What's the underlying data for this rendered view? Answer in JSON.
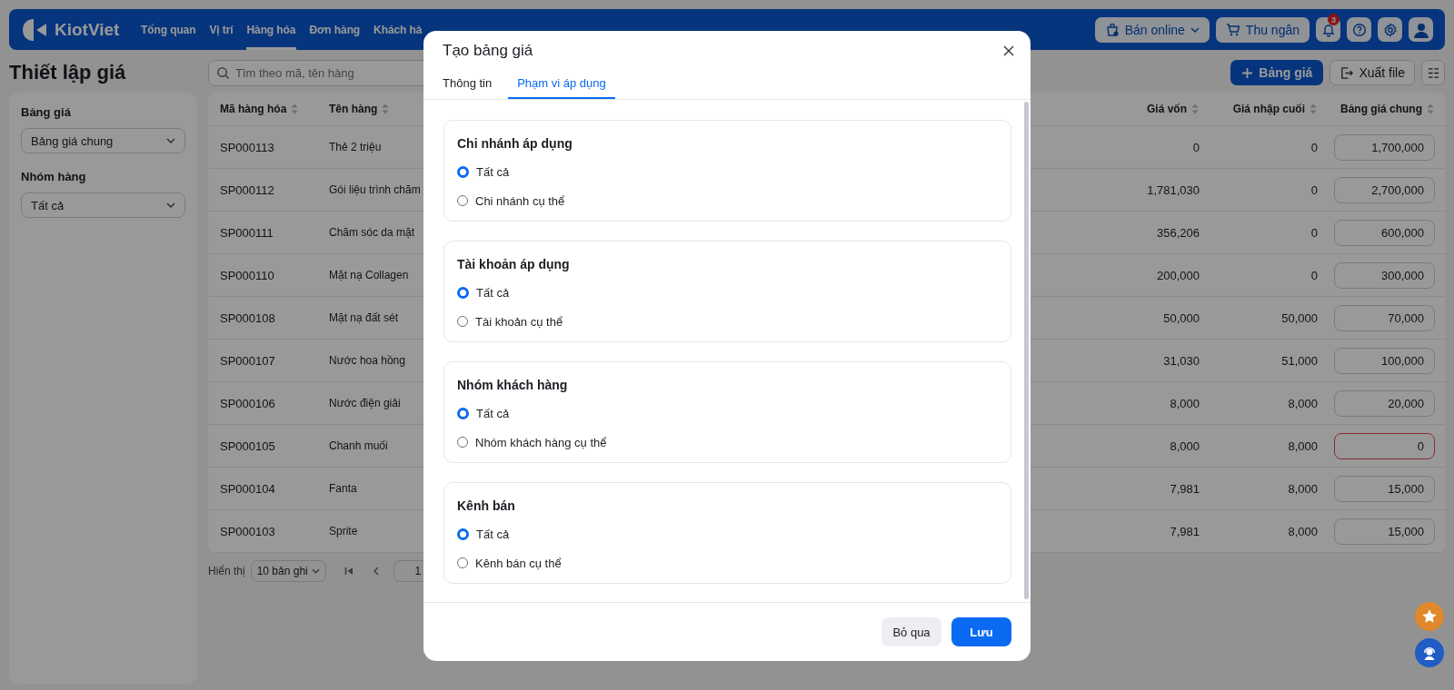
{
  "topbar": {
    "logo": "KiotViet",
    "nav": [
      {
        "label": "Tổng quan",
        "selected": false
      },
      {
        "label": "Vị trí",
        "selected": false
      },
      {
        "label": "Hàng hóa",
        "selected": true
      },
      {
        "label": "Đơn hàng",
        "selected": false
      },
      {
        "label": "Khách hà",
        "selected": false
      }
    ],
    "actions": [
      {
        "kind": "store",
        "label": "Bán online"
      },
      {
        "kind": "cashier",
        "label": "Thu ngân"
      }
    ],
    "notification_count": "3"
  },
  "page": {
    "title": "Thiết lập giá",
    "search": {
      "placeholder": "Tìm theo mã, tên hàng"
    },
    "add_button": "Bảng giá",
    "export_button": "Xuất file"
  },
  "filters": [
    {
      "label": "Bảng giá",
      "value": "Bảng giá chung"
    },
    {
      "label": "Nhóm hàng",
      "value": "Tất cả"
    }
  ],
  "table": {
    "columns": [
      "Mã hàng hóa",
      "Tên hàng",
      "Giá vốn",
      "Giá nhập cuối",
      "Bảng giá chung"
    ],
    "rows": [
      {
        "code": "SP000113",
        "name": "Thẻ 2 triệu",
        "cost": "0",
        "last_import": "0",
        "price": "1,700,000",
        "error": false
      },
      {
        "code": "SP000112",
        "name": "Gói liệu trình chăm",
        "cost": "1,781,030",
        "last_import": "0",
        "price": "2,700,000",
        "error": false
      },
      {
        "code": "SP000111",
        "name": "Chăm sóc da mặt",
        "cost": "356,206",
        "last_import": "0",
        "price": "600,000",
        "error": false
      },
      {
        "code": "SP000110",
        "name": "Mặt nạ Collagen",
        "cost": "200,000",
        "last_import": "0",
        "price": "300,000",
        "error": false
      },
      {
        "code": "SP000108",
        "name": "Mặt nạ đất sét",
        "cost": "50,000",
        "last_import": "50,000",
        "price": "70,000",
        "error": false
      },
      {
        "code": "SP000107",
        "name": "Nước hoa hồng",
        "cost": "31,030",
        "last_import": "51,000",
        "price": "100,000",
        "error": false
      },
      {
        "code": "SP000106",
        "name": "Nước điện giải",
        "cost": "8,000",
        "last_import": "8,000",
        "price": "20,000",
        "error": false
      },
      {
        "code": "SP000105",
        "name": "Chanh muối",
        "cost": "8,000",
        "last_import": "8,000",
        "price": "0",
        "error": true
      },
      {
        "code": "SP000104",
        "name": "Fanta",
        "cost": "7,981",
        "last_import": "8,000",
        "price": "15,000",
        "error": false
      },
      {
        "code": "SP000103",
        "name": "Sprite",
        "cost": "7,981",
        "last_import": "8,000",
        "price": "15,000",
        "error": false
      }
    ]
  },
  "pagination": {
    "label": "Hiển thị",
    "page_size": "10 bản ghi",
    "page": "1"
  },
  "modal": {
    "title": "Tạo bảng giá",
    "tabs": [
      {
        "label": "Thông tin",
        "selected": false
      },
      {
        "label": "Phạm vi áp dụng",
        "selected": true
      }
    ],
    "sections": [
      {
        "title": "Chi nhánh áp dụng",
        "options": [
          {
            "label": "Tất cả",
            "selected": true
          },
          {
            "label": "Chi nhánh cụ thể",
            "selected": false
          }
        ]
      },
      {
        "title": "Tài khoản áp dụng",
        "options": [
          {
            "label": "Tất cả",
            "selected": true
          },
          {
            "label": "Tài khoản cụ thể",
            "selected": false
          }
        ]
      },
      {
        "title": "Nhóm khách hàng",
        "options": [
          {
            "label": "Tất cả",
            "selected": true
          },
          {
            "label": "Nhóm khách hàng cụ thể",
            "selected": false
          }
        ]
      },
      {
        "title": "Kênh bán",
        "options": [
          {
            "label": "Tất cả",
            "selected": true
          },
          {
            "label": "Kênh bán cụ thể",
            "selected": false
          }
        ]
      }
    ],
    "buttons": [
      {
        "kind": "secondary",
        "label": "Bỏ qua"
      },
      {
        "kind": "primary",
        "label": "Lưu"
      }
    ]
  }
}
